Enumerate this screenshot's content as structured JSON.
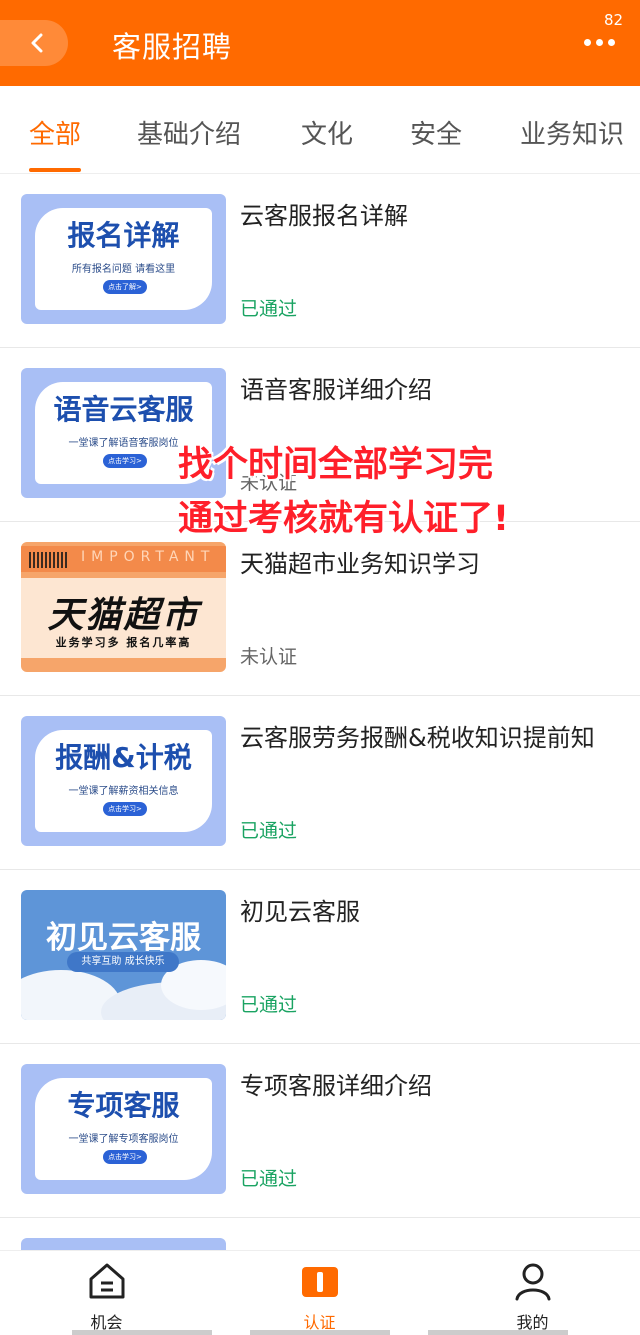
{
  "header": {
    "title": "客服招聘",
    "count": "82"
  },
  "tabs": [
    {
      "label": "全部",
      "active": true
    },
    {
      "label": "基础介绍"
    },
    {
      "label": "文化"
    },
    {
      "label": "安全"
    },
    {
      "label": "业务知识"
    }
  ],
  "courses": [
    {
      "title": "云客服报名详解",
      "status": "已通过",
      "thumb": {
        "title": "报名详解",
        "sub": "所有报名问题 请看这里",
        "pill": "点击了解>"
      }
    },
    {
      "title": "语音客服详细介绍",
      "status": "未认证",
      "thumb": {
        "title": "语音云客服",
        "sub": "一堂课了解语音客服岗位",
        "pill": "点击学习>"
      }
    },
    {
      "title": "天猫超市业务知识学习",
      "status": "未认证",
      "thumb": {
        "title": "天猫超市",
        "sub": "业务学习多 报名几率高",
        "band": "IMPORTANT"
      }
    },
    {
      "title": "云客服劳务报酬&税收知识提前知",
      "status": "已通过",
      "thumb": {
        "title": "报酬&计税",
        "sub": "一堂课了解薪资相关信息",
        "pill": "点击学习>"
      }
    },
    {
      "title": "初见云客服",
      "status": "已通过",
      "thumb": {
        "title": "初见云客服",
        "pill": "共享互助 成长快乐"
      }
    },
    {
      "title": "专项客服详细介绍",
      "status": "已通过",
      "thumb": {
        "title": "专项客服",
        "sub": "一堂课了解专项客服岗位",
        "pill": "点击学习>"
      }
    }
  ],
  "overlay": {
    "line1": "找个时间全部学习完",
    "line2": "通过考核就有认证了!"
  },
  "bottom_nav": [
    {
      "label": "机会",
      "icon": "home-icon"
    },
    {
      "label": "认证",
      "icon": "book-icon",
      "active": true
    },
    {
      "label": "我的",
      "icon": "user-icon"
    }
  ],
  "colors": {
    "accent": "#ff6a00",
    "passed": "#1aa362",
    "overlay_text": "#ff1f2a"
  }
}
